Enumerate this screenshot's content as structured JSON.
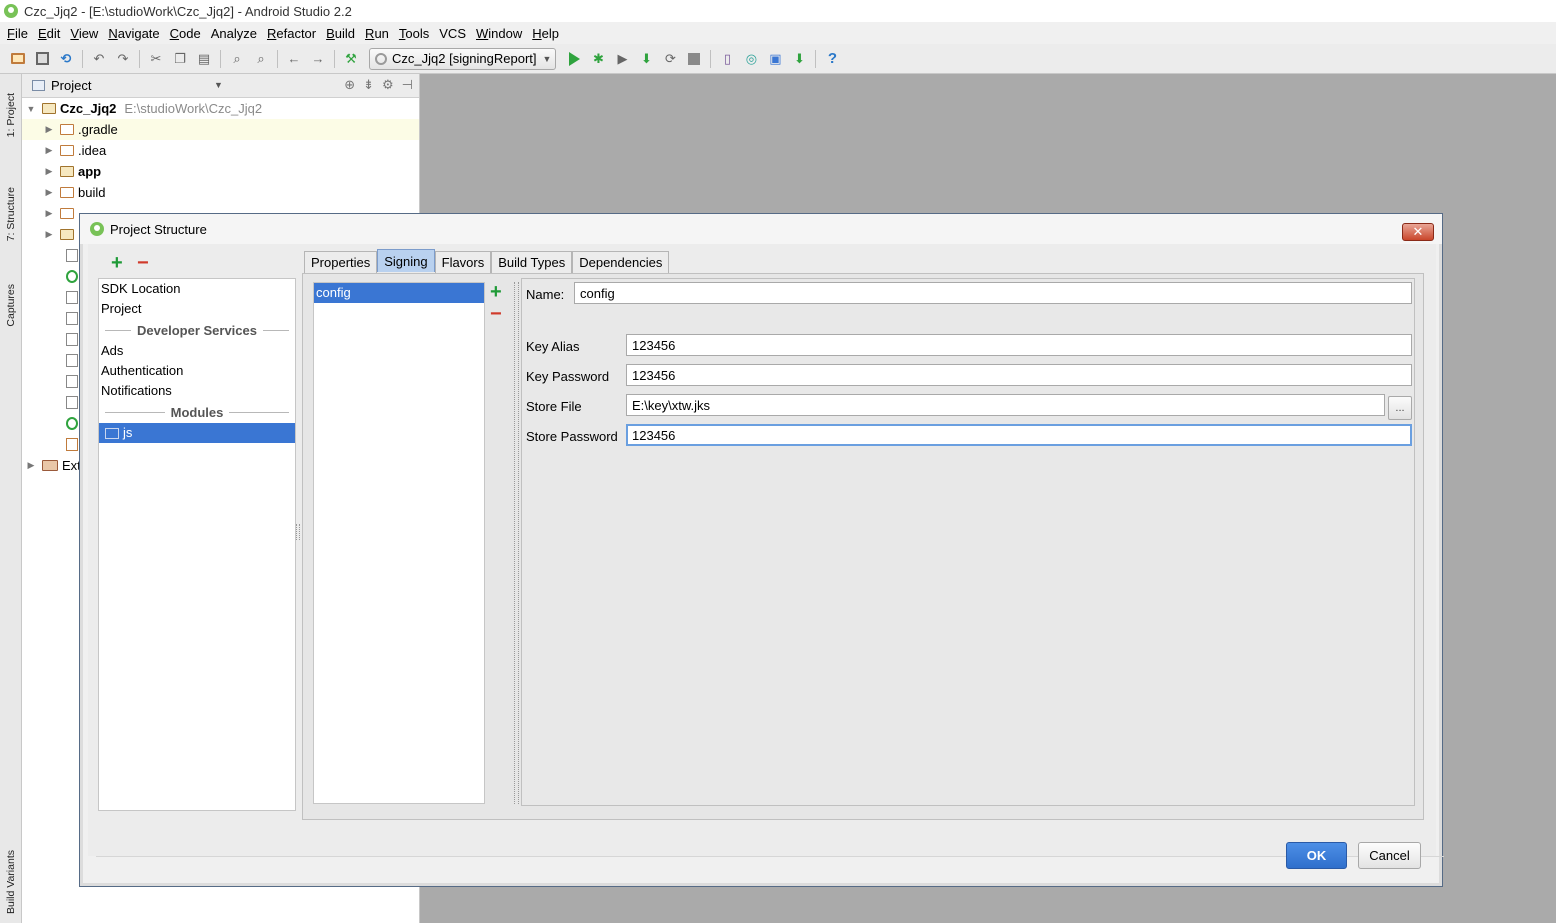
{
  "window": {
    "title": "Czc_Jjq2 - [E:\\studioWork\\Czc_Jjq2] - Android Studio 2.2"
  },
  "menu": [
    {
      "label": "File",
      "mnemonic": "F",
      "rest": "ile"
    },
    {
      "label": "Edit",
      "mnemonic": "E",
      "rest": "dit"
    },
    {
      "label": "View",
      "mnemonic": "V",
      "rest": "iew"
    },
    {
      "label": "Navigate",
      "mnemonic": "N",
      "rest": "avigate"
    },
    {
      "label": "Code",
      "mnemonic": "C",
      "rest": "ode"
    },
    {
      "label": "Analyze",
      "mnemonic": "",
      "rest": "Analyze"
    },
    {
      "label": "Refactor",
      "mnemonic": "R",
      "rest": "efactor"
    },
    {
      "label": "Build",
      "mnemonic": "B",
      "rest": "uild"
    },
    {
      "label": "Run",
      "mnemonic": "R",
      "rest": "un"
    },
    {
      "label": "Tools",
      "mnemonic": "T",
      "rest": "ools"
    },
    {
      "label": "VCS",
      "mnemonic": "",
      "rest": "VCS"
    },
    {
      "label": "Window",
      "mnemonic": "W",
      "rest": "indow"
    },
    {
      "label": "Help",
      "mnemonic": "H",
      "rest": "elp"
    }
  ],
  "toolbar": {
    "run_config": "Czc_Jjq2 [signingReport]",
    "icons": [
      "open-folder-icon",
      "save-icon",
      "sync-icon",
      "undo-icon",
      "redo-icon",
      "cut-icon",
      "copy-icon",
      "paste-icon",
      "find-icon",
      "replace-icon",
      "back-icon",
      "forward-icon",
      "make-hammer-icon",
      "run-icon",
      "debug-icon",
      "coverage-icon",
      "attach-icon",
      "rerun-icon",
      "stop-icon",
      "avd-manager-icon",
      "sync-gradle-icon",
      "project-structure-icon",
      "sdk-manager-icon",
      "help-icon"
    ]
  },
  "left_strip": {
    "tabs": [
      "1: Project",
      "7: Structure",
      "Captures",
      "Build Variants"
    ]
  },
  "project_panel": {
    "header": "Project",
    "root": {
      "name": "Czc_Jjq2",
      "path": "E:\\studioWork\\Czc_Jjq2"
    },
    "items": [
      ".gradle",
      ".idea",
      "app",
      "build"
    ],
    "ext_label": "Ext"
  },
  "dialog": {
    "title": "Project Structure",
    "config_list": {
      "items_top": [
        "SDK Location",
        "Project"
      ],
      "section_dev": "Developer Services",
      "items_dev": [
        "Ads",
        "Authentication",
        "Notifications"
      ],
      "section_modules": "Modules",
      "module": "js"
    },
    "tabs": [
      "Properties",
      "Signing",
      "Flavors",
      "Build Types",
      "Dependencies"
    ],
    "active_tab": "Signing",
    "signing_configs": [
      "config"
    ],
    "form": {
      "name_label": "Name:",
      "name_value": "config",
      "key_alias_label": "Key Alias",
      "key_alias_value": "123456",
      "key_password_label": "Key Password",
      "key_password_value": "123456",
      "store_file_label": "Store File",
      "store_file_value": "E:\\key\\xtw.jks",
      "browse_label": "...",
      "store_password_label": "Store Password",
      "store_password_value": "123456"
    },
    "ok_label": "OK",
    "cancel_label": "Cancel"
  },
  "colors": {
    "selection": "#3a76d3",
    "active_tab": "#b9d1ef",
    "ok_button": "#3a7bd8",
    "add_green": "#1f9a37",
    "remove_red": "#d03a2b"
  }
}
